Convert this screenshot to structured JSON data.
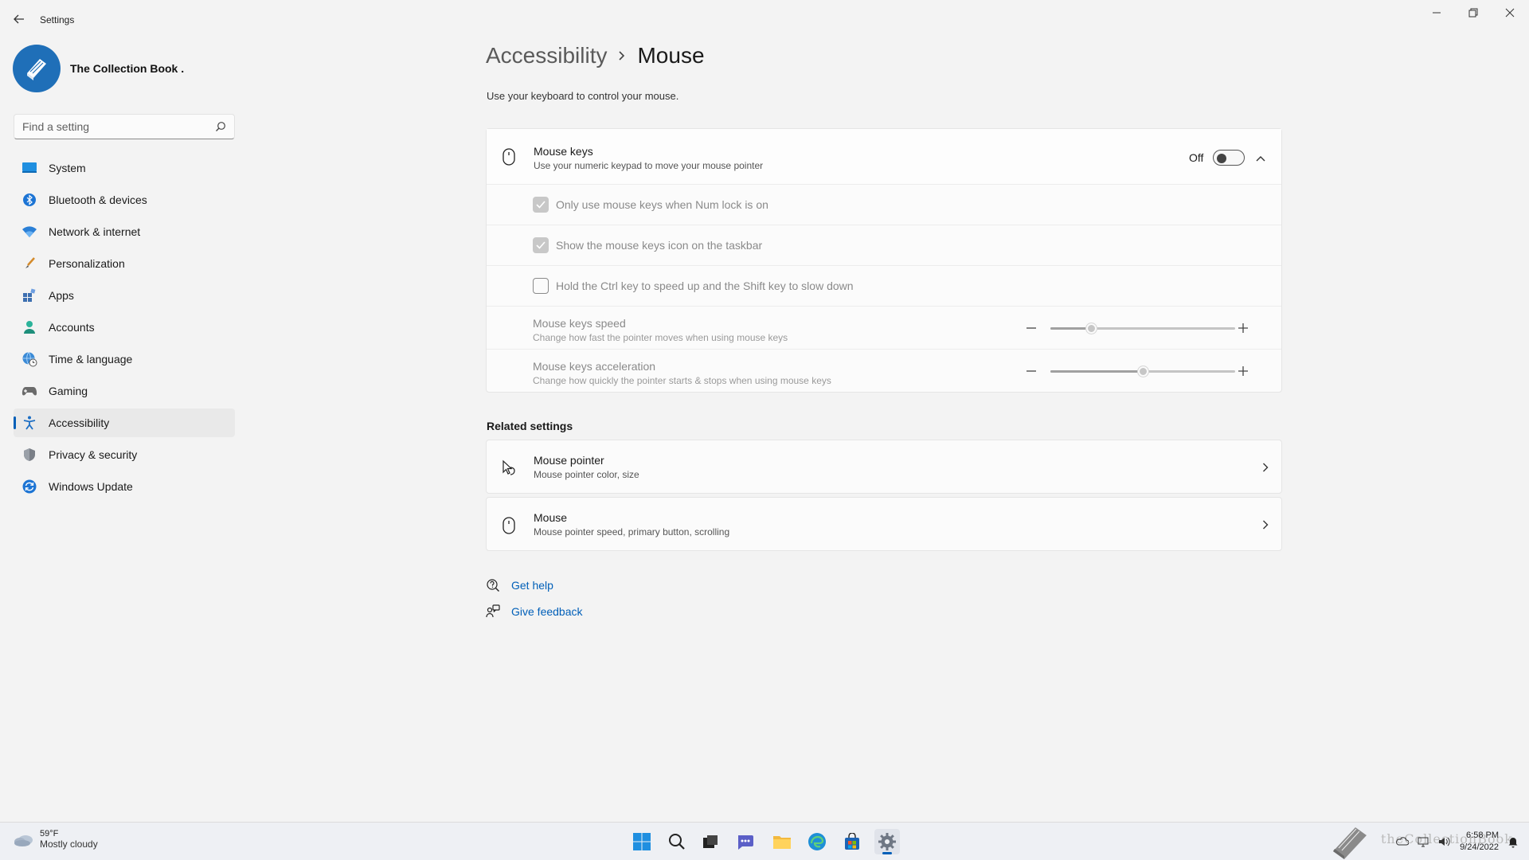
{
  "window": {
    "title": "Settings"
  },
  "profile": {
    "name": "The Collection Book ."
  },
  "search": {
    "placeholder": "Find a setting"
  },
  "sidebar": {
    "items": [
      {
        "label": "System",
        "icon": "monitor-icon"
      },
      {
        "label": "Bluetooth & devices",
        "icon": "bluetooth-icon"
      },
      {
        "label": "Network & internet",
        "icon": "wifi-icon"
      },
      {
        "label": "Personalization",
        "icon": "brush-icon"
      },
      {
        "label": "Apps",
        "icon": "apps-icon"
      },
      {
        "label": "Accounts",
        "icon": "person-icon"
      },
      {
        "label": "Time & language",
        "icon": "globe-clock-icon"
      },
      {
        "label": "Gaming",
        "icon": "gamepad-icon"
      },
      {
        "label": "Accessibility",
        "icon": "accessibility-icon",
        "active": true
      },
      {
        "label": "Privacy & security",
        "icon": "shield-icon"
      },
      {
        "label": "Windows Update",
        "icon": "update-icon"
      }
    ]
  },
  "header": {
    "parent": "Accessibility",
    "current": "Mouse",
    "subtitle": "Use your keyboard to control your mouse."
  },
  "mouse_keys": {
    "title": "Mouse keys",
    "description": "Use your numeric keypad to move your mouse pointer",
    "state": "Off",
    "options": [
      {
        "label": "Only use mouse keys when Num lock is on",
        "checked": true,
        "enabled": false
      },
      {
        "label": "Show the mouse keys icon on the taskbar",
        "checked": true,
        "enabled": false
      },
      {
        "label": "Hold the Ctrl key to speed up and the Shift key to slow down",
        "checked": false,
        "enabled": false
      }
    ],
    "speed": {
      "title": "Mouse keys speed",
      "description": "Change how fast the pointer moves when using mouse keys",
      "value_fraction": 0.22
    },
    "acceleration": {
      "title": "Mouse keys acceleration",
      "description": "Change how quickly the pointer starts & stops when using mouse keys",
      "value_fraction": 0.5
    }
  },
  "related": {
    "heading": "Related settings",
    "items": [
      {
        "title": "Mouse pointer",
        "description": "Mouse pointer color, size"
      },
      {
        "title": "Mouse",
        "description": "Mouse pointer speed, primary button, scrolling"
      }
    ]
  },
  "help": {
    "get_help": "Get help",
    "give_feedback": "Give feedback"
  },
  "taskbar": {
    "weather_temp": "59°F",
    "weather_cond": "Mostly cloudy",
    "time": "6:58 PM",
    "date": "9/24/2022",
    "watermark": "theCollectionBook"
  },
  "colors": {
    "accent": "#005fb8",
    "background": "#f3f3f3",
    "card": "#fbfbfb"
  }
}
